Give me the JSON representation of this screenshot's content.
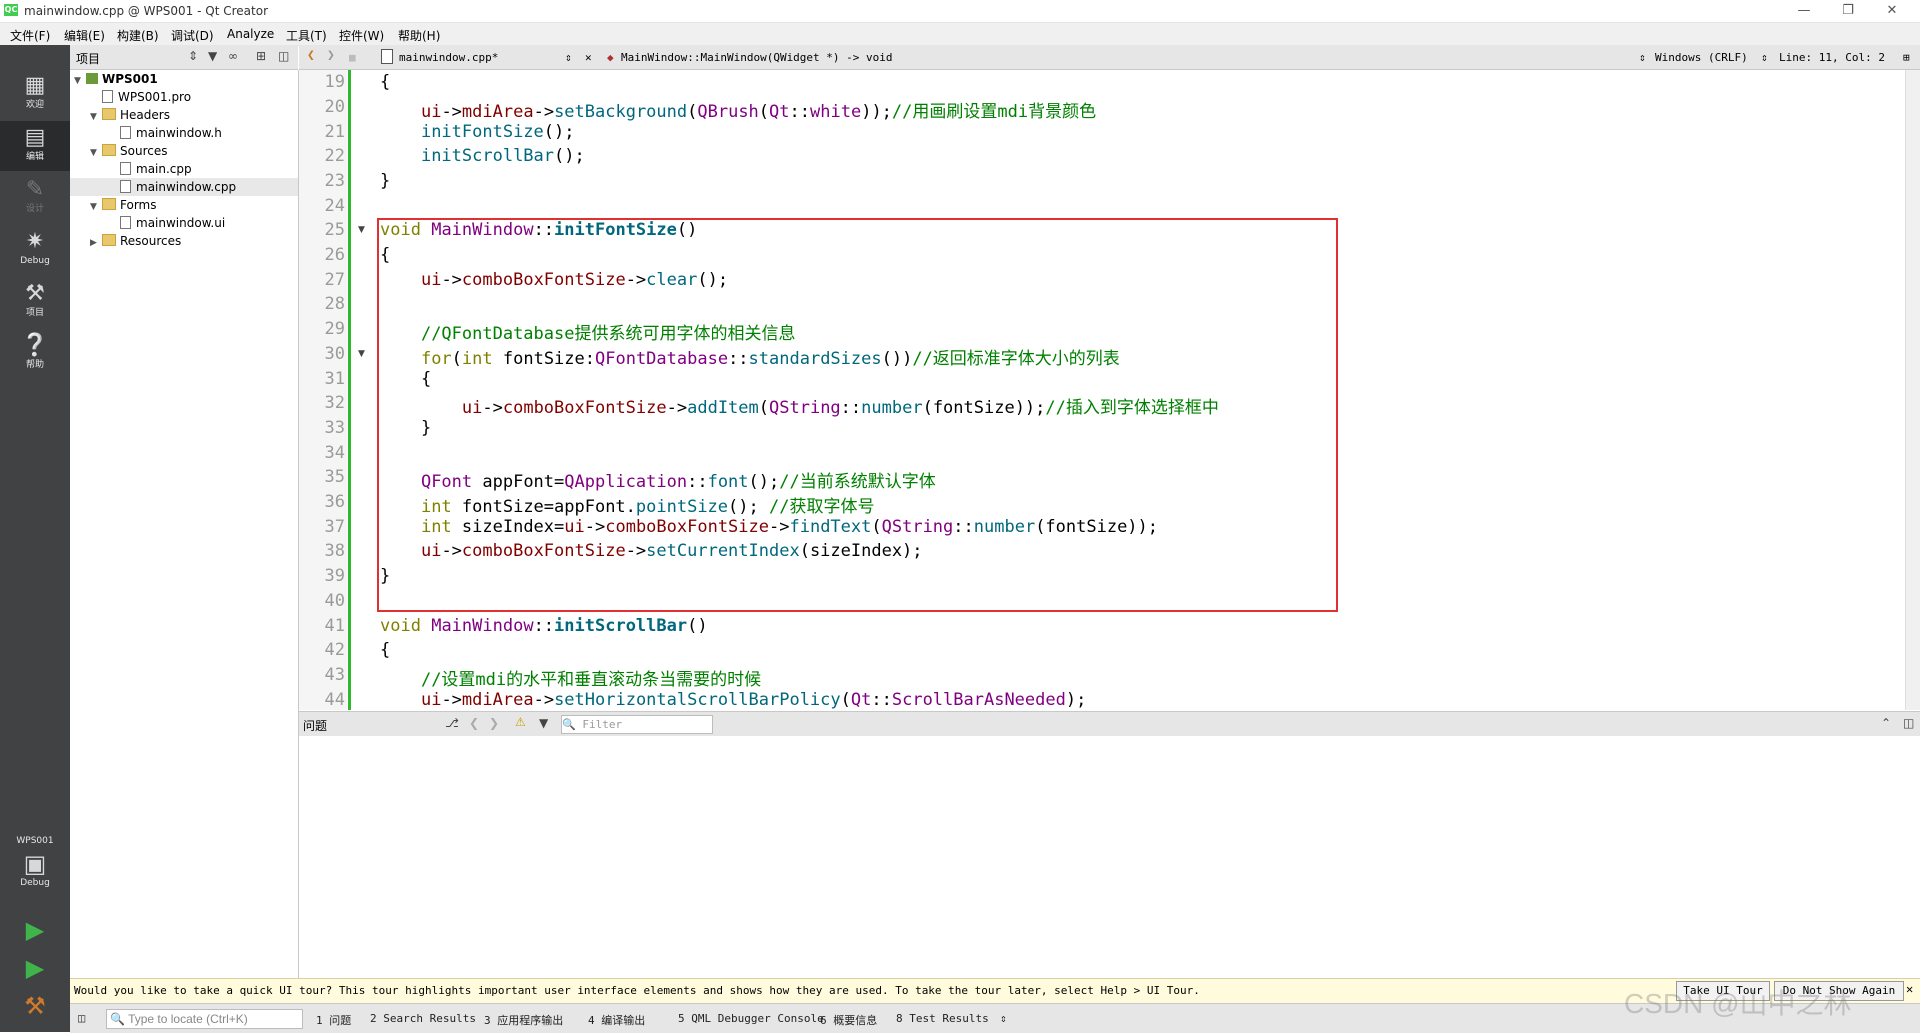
{
  "window": {
    "title": "mainwindow.cpp @ WPS001 - Qt Creator",
    "logo": "QC"
  },
  "menu": [
    "文件(F)",
    "编辑(E)",
    "构建(B)",
    "调试(D)",
    "Analyze",
    "工具(T)",
    "控件(W)",
    "帮助(H)"
  ],
  "modes": [
    {
      "label": "欢迎",
      "icon": "welcome-grid-icon"
    },
    {
      "label": "编辑",
      "icon": "edit-document-icon"
    },
    {
      "label": "设计",
      "icon": "design-pencil-icon"
    },
    {
      "label": "Debug",
      "icon": "debug-bug-icon"
    },
    {
      "label": "项目",
      "icon": "projects-wrench-icon"
    },
    {
      "label": "帮助",
      "icon": "help-question-icon"
    }
  ],
  "kit": {
    "project": "WPS001",
    "config": "Debug"
  },
  "project_pane": {
    "title": "项目",
    "tree": [
      {
        "label": "WPS001",
        "kind": "project",
        "depth": 0
      },
      {
        "label": "WPS001.pro",
        "kind": "file",
        "depth": 1
      },
      {
        "label": "Headers",
        "kind": "folder",
        "depth": 1
      },
      {
        "label": "mainwindow.h",
        "kind": "file",
        "depth": 2
      },
      {
        "label": "Sources",
        "kind": "folder",
        "depth": 1
      },
      {
        "label": "main.cpp",
        "kind": "file",
        "depth": 2
      },
      {
        "label": "mainwindow.cpp",
        "kind": "file",
        "depth": 2
      },
      {
        "label": "Forms",
        "kind": "folder",
        "depth": 1
      },
      {
        "label": "mainwindow.ui",
        "kind": "file",
        "depth": 2
      },
      {
        "label": "Resources",
        "kind": "folder",
        "depth": 1
      }
    ]
  },
  "editor_toolbar": {
    "file": "mainwindow.cpp*",
    "symbol": "MainWindow::MainWindow(QWidget *) -> void",
    "line_ending": "Windows (CRLF)",
    "position": "Line: 11, Col: 2"
  },
  "line_numbers": [
    "19",
    "20",
    "21",
    "22",
    "23",
    "24",
    "25",
    "26",
    "27",
    "28",
    "29",
    "30",
    "31",
    "32",
    "33",
    "34",
    "35",
    "36",
    "37",
    "38",
    "39",
    "40",
    "41",
    "42",
    "43",
    "44"
  ],
  "issues": {
    "title": "问题",
    "filter_placeholder": "Filter"
  },
  "infobar": {
    "message": "Would you like to take a quick UI tour? This tour highlights important user interface elements and shows how they are used. To take the tour later, select Help > UI Tour.",
    "take_tour": "Take UI Tour",
    "dont_show": "Do Not Show Again"
  },
  "statusbar": {
    "locator_placeholder": "Type to locate (Ctrl+K)",
    "tabs": [
      "1 问题",
      "2 Search Results",
      "3 应用程序输出",
      "4 编译输出",
      "5 QML Debugger Console",
      "6 概要信息",
      "8 Test Results"
    ]
  },
  "watermark": "CSDN @山中之林"
}
